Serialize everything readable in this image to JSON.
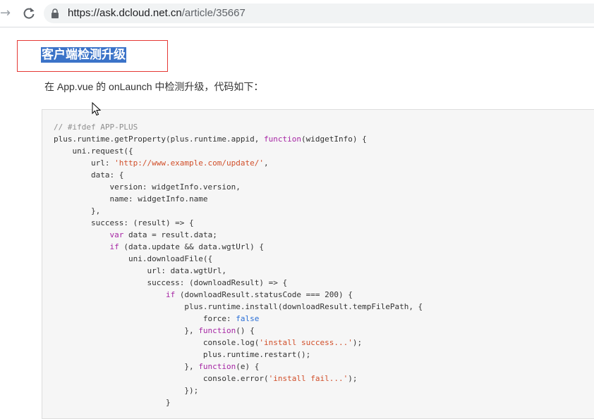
{
  "browser": {
    "url_host": "https://ask.dcloud.net.cn",
    "url_path": "/article/35667"
  },
  "article": {
    "heading": "客户端检测升级",
    "intro": "在 App.vue 的 onLaunch 中检测升级，代码如下："
  },
  "code_lines": [
    [
      {
        "t": "// #ifdef APP-PLUS",
        "c": "comment"
      }
    ],
    [
      {
        "t": "plus.runtime.getProperty(plus.runtime.appid, ",
        "c": "plain"
      },
      {
        "t": "function",
        "c": "keyword"
      },
      {
        "t": "(widgetInfo) {",
        "c": "plain"
      }
    ],
    [
      {
        "t": "    uni.request({",
        "c": "plain"
      }
    ],
    [
      {
        "t": "        url: ",
        "c": "plain"
      },
      {
        "t": "'http://www.example.com/update/'",
        "c": "string"
      },
      {
        "t": ",",
        "c": "plain"
      }
    ],
    [
      {
        "t": "        data: {",
        "c": "plain"
      }
    ],
    [
      {
        "t": "            version: widgetInfo.version,",
        "c": "plain"
      }
    ],
    [
      {
        "t": "            name: widgetInfo.name",
        "c": "plain"
      }
    ],
    [
      {
        "t": "        },",
        "c": "plain"
      }
    ],
    [
      {
        "t": "        success: (result) => {",
        "c": "plain"
      }
    ],
    [
      {
        "t": "            ",
        "c": "plain"
      },
      {
        "t": "var",
        "c": "keyword"
      },
      {
        "t": " data = result.data;",
        "c": "plain"
      }
    ],
    [
      {
        "t": "            ",
        "c": "plain"
      },
      {
        "t": "if",
        "c": "keyword"
      },
      {
        "t": " (data.update && data.wgtUrl) {",
        "c": "plain"
      }
    ],
    [
      {
        "t": "                uni.downloadFile({",
        "c": "plain"
      }
    ],
    [
      {
        "t": "                    url: data.wgtUrl,",
        "c": "plain"
      }
    ],
    [
      {
        "t": "                    success: (downloadResult) => {",
        "c": "plain"
      }
    ],
    [
      {
        "t": "                        ",
        "c": "plain"
      },
      {
        "t": "if",
        "c": "keyword"
      },
      {
        "t": " (downloadResult.statusCode === 200) {",
        "c": "plain"
      }
    ],
    [
      {
        "t": "                            plus.runtime.install(downloadResult.tempFilePath, {",
        "c": "plain"
      }
    ],
    [
      {
        "t": "                                force: ",
        "c": "plain"
      },
      {
        "t": "false",
        "c": "literal"
      }
    ],
    [
      {
        "t": "                            }, ",
        "c": "plain"
      },
      {
        "t": "function",
        "c": "keyword"
      },
      {
        "t": "() {",
        "c": "plain"
      }
    ],
    [
      {
        "t": "                                console.log(",
        "c": "plain"
      },
      {
        "t": "'install success...'",
        "c": "string"
      },
      {
        "t": ");",
        "c": "plain"
      }
    ],
    [
      {
        "t": "                                plus.runtime.restart();",
        "c": "plain"
      }
    ],
    [
      {
        "t": "                            }, ",
        "c": "plain"
      },
      {
        "t": "function",
        "c": "keyword"
      },
      {
        "t": "(e) {",
        "c": "plain"
      }
    ],
    [
      {
        "t": "                                console.error(",
        "c": "plain"
      },
      {
        "t": "'install fail...'",
        "c": "string"
      },
      {
        "t": ");",
        "c": "plain"
      }
    ],
    [
      {
        "t": "                            });",
        "c": "plain"
      }
    ],
    [
      {
        "t": "                        }",
        "c": "plain"
      }
    ]
  ]
}
